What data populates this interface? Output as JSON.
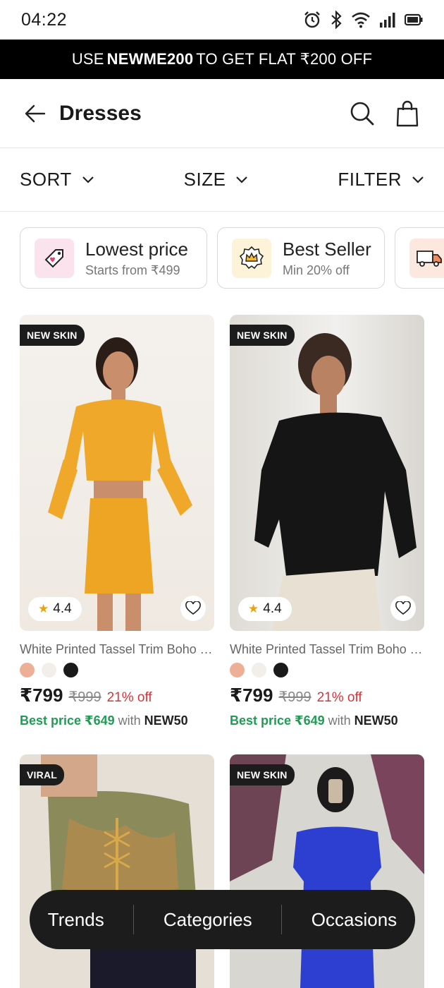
{
  "status": {
    "time": "04:22",
    "icons": [
      "alarm-icon",
      "bluetooth-icon",
      "wifi-icon",
      "signal-icon",
      "battery-icon"
    ]
  },
  "promo": {
    "prefix": "USE",
    "code": "NEWME200",
    "suffix": "TO GET FLAT ₹200 OFF"
  },
  "header": {
    "title": "Dresses"
  },
  "controls": {
    "sort": "SORT",
    "size": "SIZE",
    "filter": "FILTER"
  },
  "chips": [
    {
      "title": "Lowest price",
      "subtitle": "Starts from ₹499",
      "icon": "price-tag-icon",
      "color": "#fbe3ee"
    },
    {
      "title": "Best Seller",
      "subtitle": "Min 20% off",
      "icon": "crown-badge-icon",
      "color": "#fdf3d8"
    },
    {
      "title": "",
      "subtitle": "",
      "icon": "delivery-truck-icon",
      "color": "#fde8df"
    }
  ],
  "products": [
    {
      "tag": "NEW SKIN",
      "rating": "4.4",
      "name": "White Printed Tassel Trim Boho T...",
      "swatches": [
        "#eeaf97",
        "#f2eeea",
        "#1a1a1a"
      ],
      "price": "₹799",
      "mrp": "₹999",
      "discount": "21% off",
      "best_label": "Best price ₹649",
      "best_with": "with",
      "best_code": "NEW50"
    },
    {
      "tag": "NEW SKIN",
      "rating": "4.4",
      "name": "White Printed Tassel Trim Boho T...",
      "swatches": [
        "#eeaf97",
        "#f2eeea",
        "#1a1a1a"
      ],
      "price": "₹799",
      "mrp": "₹999",
      "discount": "21% off",
      "best_label": "Best price ₹649",
      "best_with": "with",
      "best_code": "NEW50"
    },
    {
      "tag": "VIRAL"
    },
    {
      "tag": "NEW SKIN"
    }
  ],
  "bottom_nav": {
    "trends": "Trends",
    "categories": "Categories",
    "occasions": "Occasions"
  }
}
